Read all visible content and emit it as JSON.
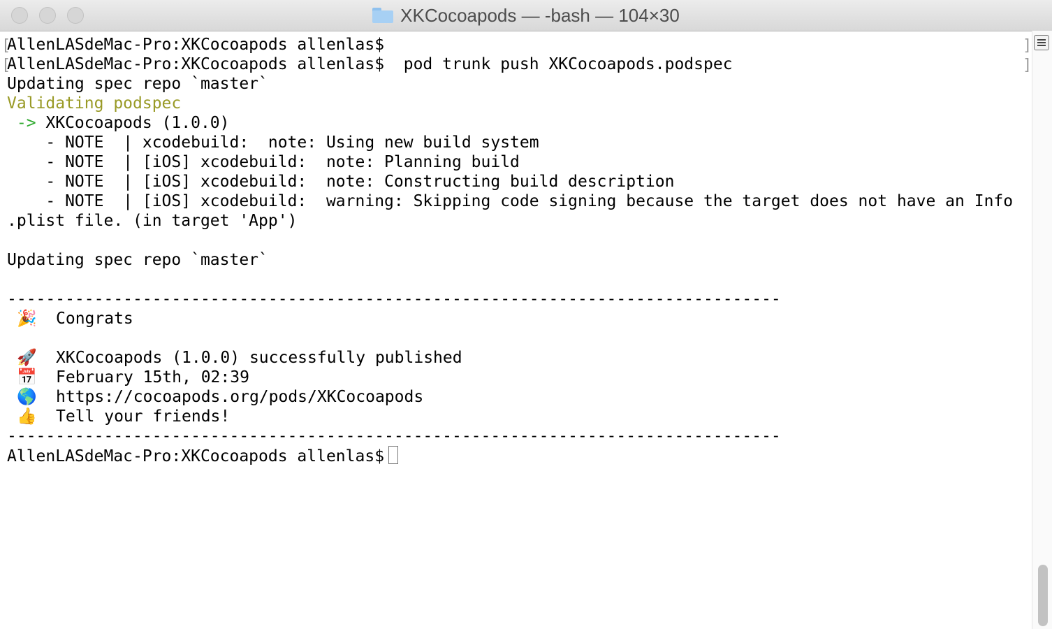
{
  "window": {
    "title": "XKCocoapods — -bash — 104×30"
  },
  "terminal": {
    "lines": [
      "AllenLASdeMac-Pro:XKCocoapods allenlas$",
      "AllenLASdeMac-Pro:XKCocoapods allenlas$  pod trunk push XKCocoapods.podspec",
      "Updating spec repo `master`",
      "Validating podspec",
      " -> ",
      "XKCocoapods (1.0.0)",
      "    - NOTE  | xcodebuild:  note: Using new build system",
      "    - NOTE  | [iOS] xcodebuild:  note: Planning build",
      "    - NOTE  | [iOS] xcodebuild:  note: Constructing build description",
      "    - NOTE  | [iOS] xcodebuild:  warning: Skipping code signing because the target does not have an Info",
      ".plist file. (in target 'App')",
      "Updating spec repo `master`",
      "--------------------------------------------------------------------------------",
      "Congrats",
      "XKCocoapods (1.0.0) successfully published",
      "February 15th, 02:39",
      "https://cocoapods.org/pods/XKCocoapods",
      "Tell your friends!",
      "AllenLASdeMac-Pro:XKCocoapods allenlas$"
    ],
    "emoji": {
      "party": "🎉",
      "rocket": "🚀",
      "calendar": "📅",
      "globe": "🌎",
      "thumbs": "👍"
    },
    "colors": {
      "arrow": "#2faa2f",
      "validating": "#999a26"
    }
  },
  "icons": {
    "folder": "folder-icon",
    "scroll_button": "split-pane-icon"
  }
}
